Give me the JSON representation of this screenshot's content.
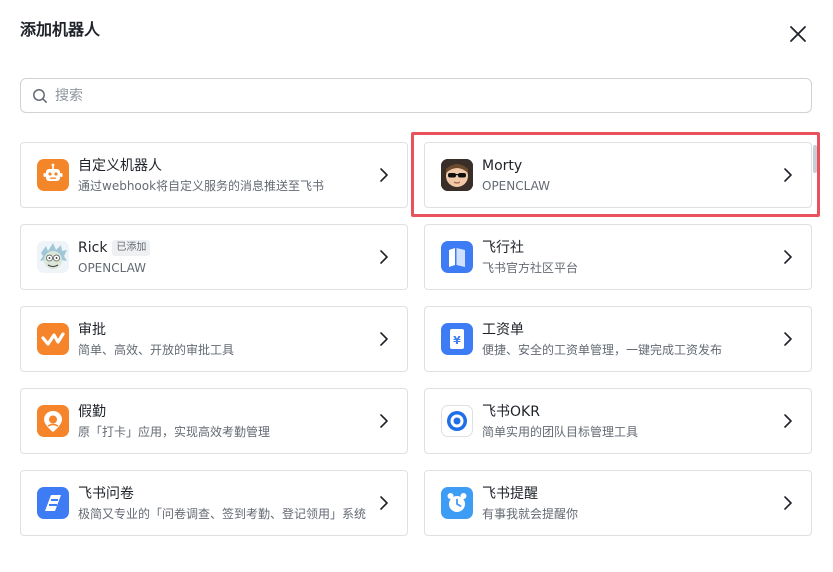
{
  "dialog": {
    "title": "添加机器人",
    "close_icon": "close-icon"
  },
  "search": {
    "placeholder": "搜索",
    "value": "",
    "icon": "search-icon"
  },
  "bots": [
    {
      "name": "自定义机器人",
      "desc": "通过webhook将自定义服务的消息推送至飞书",
      "icon": "robot-icon",
      "color": "#f4862a"
    },
    {
      "name": "Morty",
      "desc": "OPENCLAW",
      "icon": "morty-avatar-icon",
      "color": "#2b2b2b"
    },
    {
      "name": "Rick",
      "badge": "已添加",
      "desc": "OPENCLAW",
      "icon": "rick-avatar-icon",
      "color": "#9fc7d8"
    },
    {
      "name": "飞行社",
      "desc": "飞书官方社区平台",
      "icon": "book-icon",
      "color": "#3d7cf4"
    },
    {
      "name": "审批",
      "desc": "简单、高效、开放的审批工具",
      "icon": "check-icon",
      "color": "#f5842a"
    },
    {
      "name": "工资单",
      "desc": "便捷、安全的工资单管理，一键完成工资发布",
      "icon": "yuan-document-icon",
      "color": "#3d7cf4"
    },
    {
      "name": "假勤",
      "desc": "原「打卡」应用，实现高效考勤管理",
      "icon": "location-pin-icon",
      "color": "#f5842a"
    },
    {
      "name": "飞书OKR",
      "desc": "简单实用的团队目标管理工具",
      "icon": "target-icon",
      "color": "#1e6fe8"
    },
    {
      "name": "飞书问卷",
      "desc": "极简又专业的「问卷调查、签到考勤、登记领用」系统",
      "icon": "survey-icon",
      "color": "#3d7cf4"
    },
    {
      "name": "飞书提醒",
      "desc": "有事我就会提醒你",
      "icon": "alarm-clock-icon",
      "color": "#3d9cf4"
    }
  ],
  "colors": {
    "highlight": "#e8525c",
    "border": "#dee0e3",
    "text_primary": "#1f2329",
    "text_secondary": "#646a73"
  }
}
